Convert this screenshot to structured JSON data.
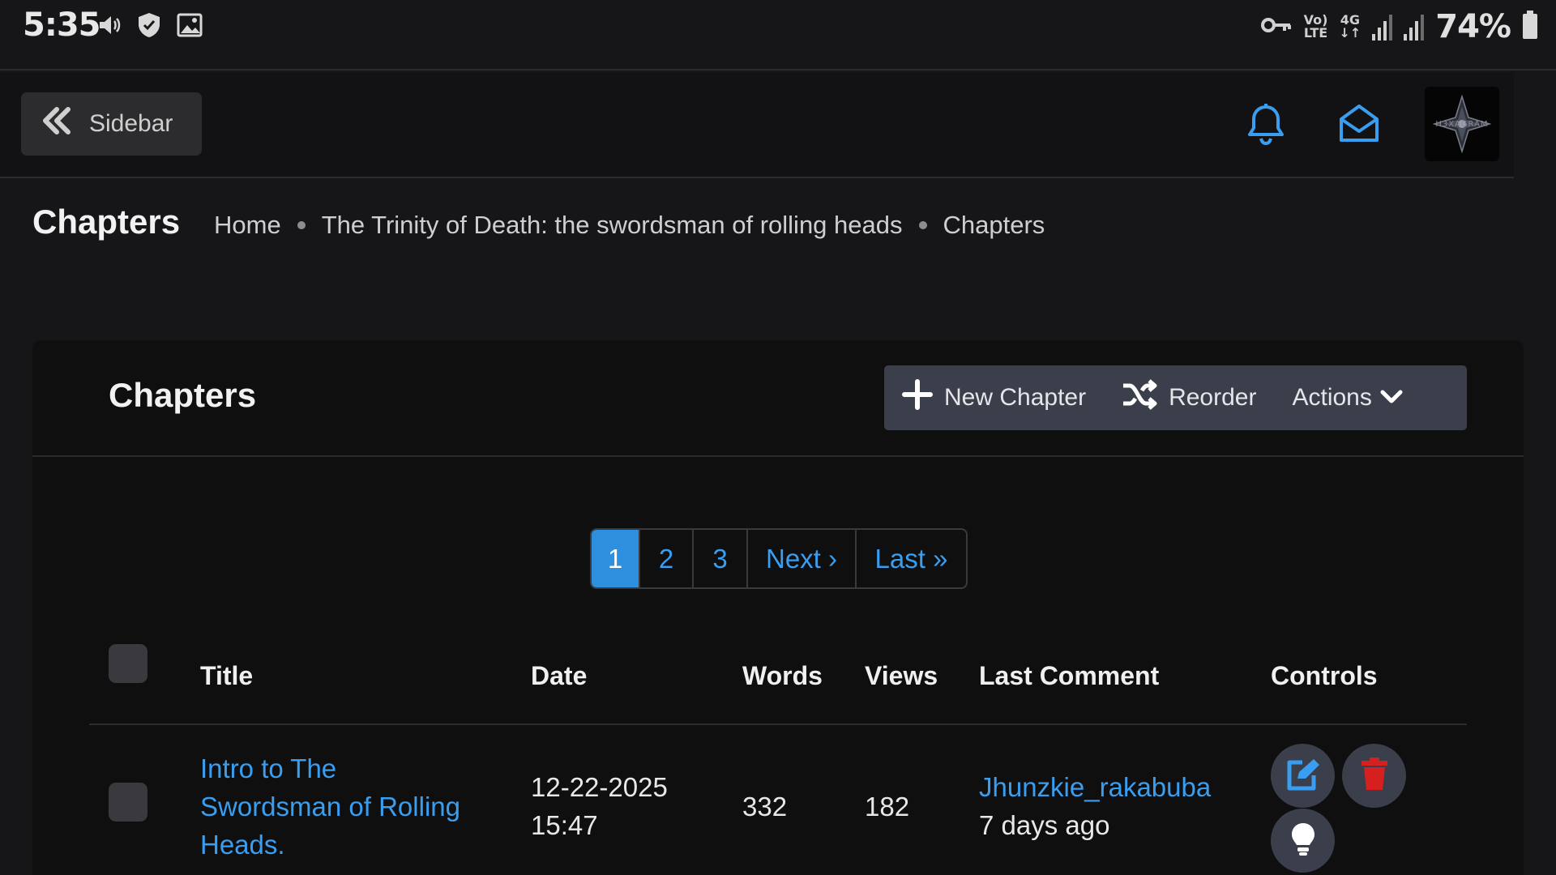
{
  "status_bar": {
    "time": "5:35",
    "network_top": "Vo)",
    "network_bottom": "LTE",
    "signal_label": "4G",
    "battery": "74%",
    "icons": [
      "volume-icon",
      "shield-icon",
      "image-icon",
      "key-icon",
      "signal-icon",
      "battery-icon"
    ]
  },
  "topbar": {
    "sidebar_label": "Sidebar",
    "avatar_text": "H3XAGRAM",
    "accent": "#3a9ef0"
  },
  "heading": {
    "title": "Chapters",
    "breadcrumbs": [
      "Home",
      "The Trinity of Death: the swordsman of rolling heads",
      "Chapters"
    ]
  },
  "card": {
    "title": "Chapters",
    "buttons": {
      "new_chapter": "New Chapter",
      "reorder": "Reorder",
      "actions": "Actions"
    }
  },
  "pagination": {
    "pages": [
      "1",
      "2",
      "3"
    ],
    "active": "1",
    "next": "Next ›",
    "last": "Last »"
  },
  "table": {
    "headers": [
      "Title",
      "Date",
      "Words",
      "Views",
      "Last Comment",
      "Controls"
    ],
    "rows": [
      {
        "title_lines": [
          "Intro to The",
          "Swordsman of Rolling",
          "Heads."
        ],
        "date": "12-22-2025",
        "time": "15:47",
        "words": "332",
        "views": "182",
        "last_comment_user": "Jhunzkie_rakabuba",
        "last_comment_time": "7 days ago"
      }
    ]
  },
  "colors": {
    "edit_button": "#3a3f4b",
    "delete_button": "#3a3f4b",
    "delete_icon": "#d62020",
    "primary": "#2e8fdf"
  }
}
